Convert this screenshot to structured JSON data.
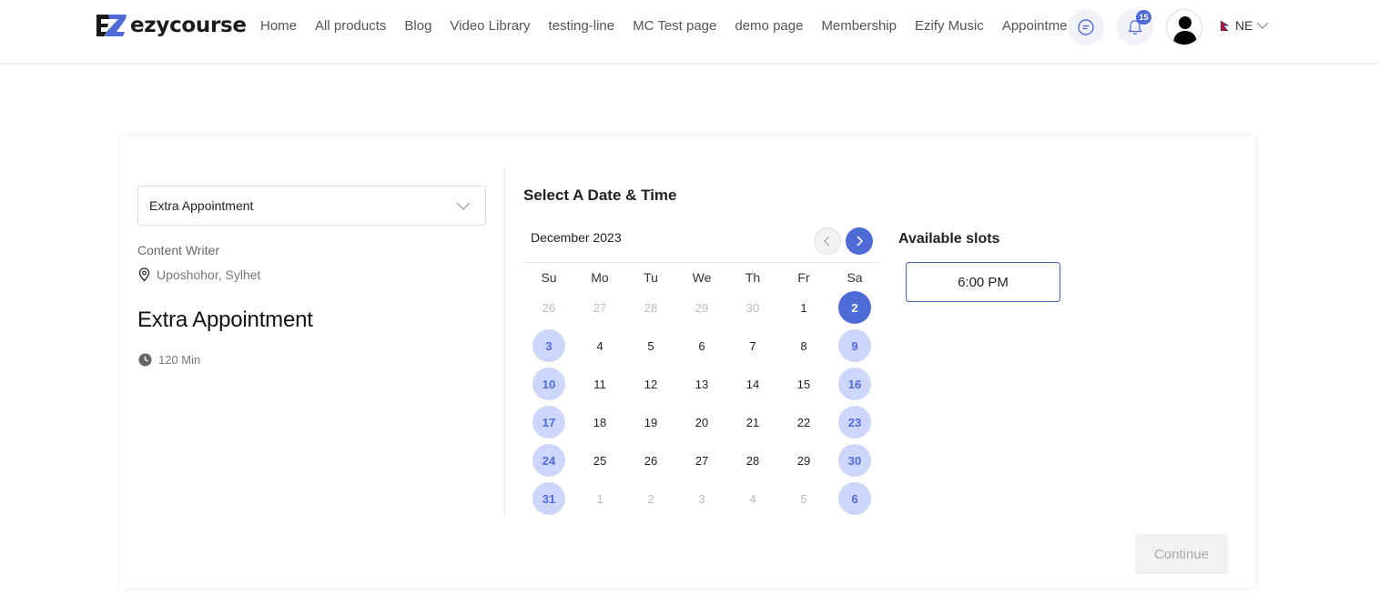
{
  "brand": {
    "name": "ezycourse",
    "accent": "#4f6bd8"
  },
  "nav": {
    "items": [
      "Home",
      "All products",
      "Blog",
      "Video Library",
      "testing-line",
      "MC Test page",
      "demo page",
      "Membership",
      "Ezify Music",
      "Appointment"
    ]
  },
  "header": {
    "notifications_count": "15",
    "language": "NE",
    "icons": [
      "chat-icon",
      "bell-icon",
      "user-avatar-icon",
      "nepal-flag-icon",
      "chevron-down-icon"
    ]
  },
  "booking": {
    "selected_event": "Extra Appointment",
    "role": "Content Writer",
    "location": "Uposhohor, Sylhet",
    "title": "Extra Appointment",
    "duration": "120 Min"
  },
  "calendar": {
    "section_title": "Select A Date & Time",
    "month_label": "December 2023",
    "weekdays": [
      "Su",
      "Mo",
      "Tu",
      "We",
      "Th",
      "Fr",
      "Sa"
    ],
    "days": [
      {
        "d": "26",
        "s": "muted"
      },
      {
        "d": "27",
        "s": "muted"
      },
      {
        "d": "28",
        "s": "muted"
      },
      {
        "d": "29",
        "s": "muted"
      },
      {
        "d": "30",
        "s": "muted"
      },
      {
        "d": "1",
        "s": "normal"
      },
      {
        "d": "2",
        "s": "selected"
      },
      {
        "d": "3",
        "s": "avail"
      },
      {
        "d": "4",
        "s": "normal"
      },
      {
        "d": "5",
        "s": "normal"
      },
      {
        "d": "6",
        "s": "normal"
      },
      {
        "d": "7",
        "s": "normal"
      },
      {
        "d": "8",
        "s": "normal"
      },
      {
        "d": "9",
        "s": "avail"
      },
      {
        "d": "10",
        "s": "avail"
      },
      {
        "d": "11",
        "s": "normal"
      },
      {
        "d": "12",
        "s": "normal"
      },
      {
        "d": "13",
        "s": "normal"
      },
      {
        "d": "14",
        "s": "normal"
      },
      {
        "d": "15",
        "s": "normal"
      },
      {
        "d": "16",
        "s": "avail"
      },
      {
        "d": "17",
        "s": "avail"
      },
      {
        "d": "18",
        "s": "normal"
      },
      {
        "d": "19",
        "s": "normal"
      },
      {
        "d": "20",
        "s": "normal"
      },
      {
        "d": "21",
        "s": "normal"
      },
      {
        "d": "22",
        "s": "normal"
      },
      {
        "d": "23",
        "s": "avail"
      },
      {
        "d": "24",
        "s": "avail"
      },
      {
        "d": "25",
        "s": "normal"
      },
      {
        "d": "26",
        "s": "normal"
      },
      {
        "d": "27",
        "s": "normal"
      },
      {
        "d": "28",
        "s": "normal"
      },
      {
        "d": "29",
        "s": "normal"
      },
      {
        "d": "30",
        "s": "avail"
      },
      {
        "d": "31",
        "s": "avail"
      },
      {
        "d": "1",
        "s": "muted"
      },
      {
        "d": "2",
        "s": "muted"
      },
      {
        "d": "3",
        "s": "muted"
      },
      {
        "d": "4",
        "s": "muted"
      },
      {
        "d": "5",
        "s": "muted"
      },
      {
        "d": "6",
        "s": "avail"
      }
    ]
  },
  "slots": {
    "title": "Available slots",
    "items": [
      "6:00 PM"
    ]
  },
  "actions": {
    "continue_label": "Continue"
  }
}
